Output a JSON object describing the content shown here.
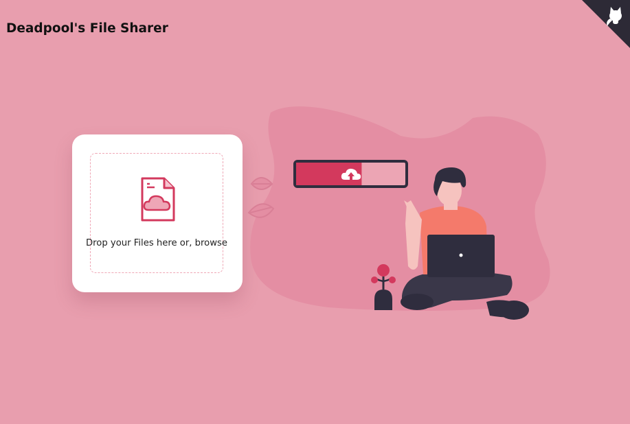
{
  "header": {
    "title": "Deadpool's File Sharer"
  },
  "corner": {
    "icon": "github-octocat-icon",
    "color": "#2d2a36"
  },
  "upload": {
    "prompt_text": "Drop your Files here or, ",
    "browse_label": "browse",
    "icon": "file-cloud-icon"
  },
  "illustration": {
    "progress": 0.6,
    "icon": "cloud-upload-icon"
  },
  "colors": {
    "background": "#e89eae",
    "accent": "#d3395d",
    "dark": "#2f2d3e",
    "card": "#ffffff"
  }
}
